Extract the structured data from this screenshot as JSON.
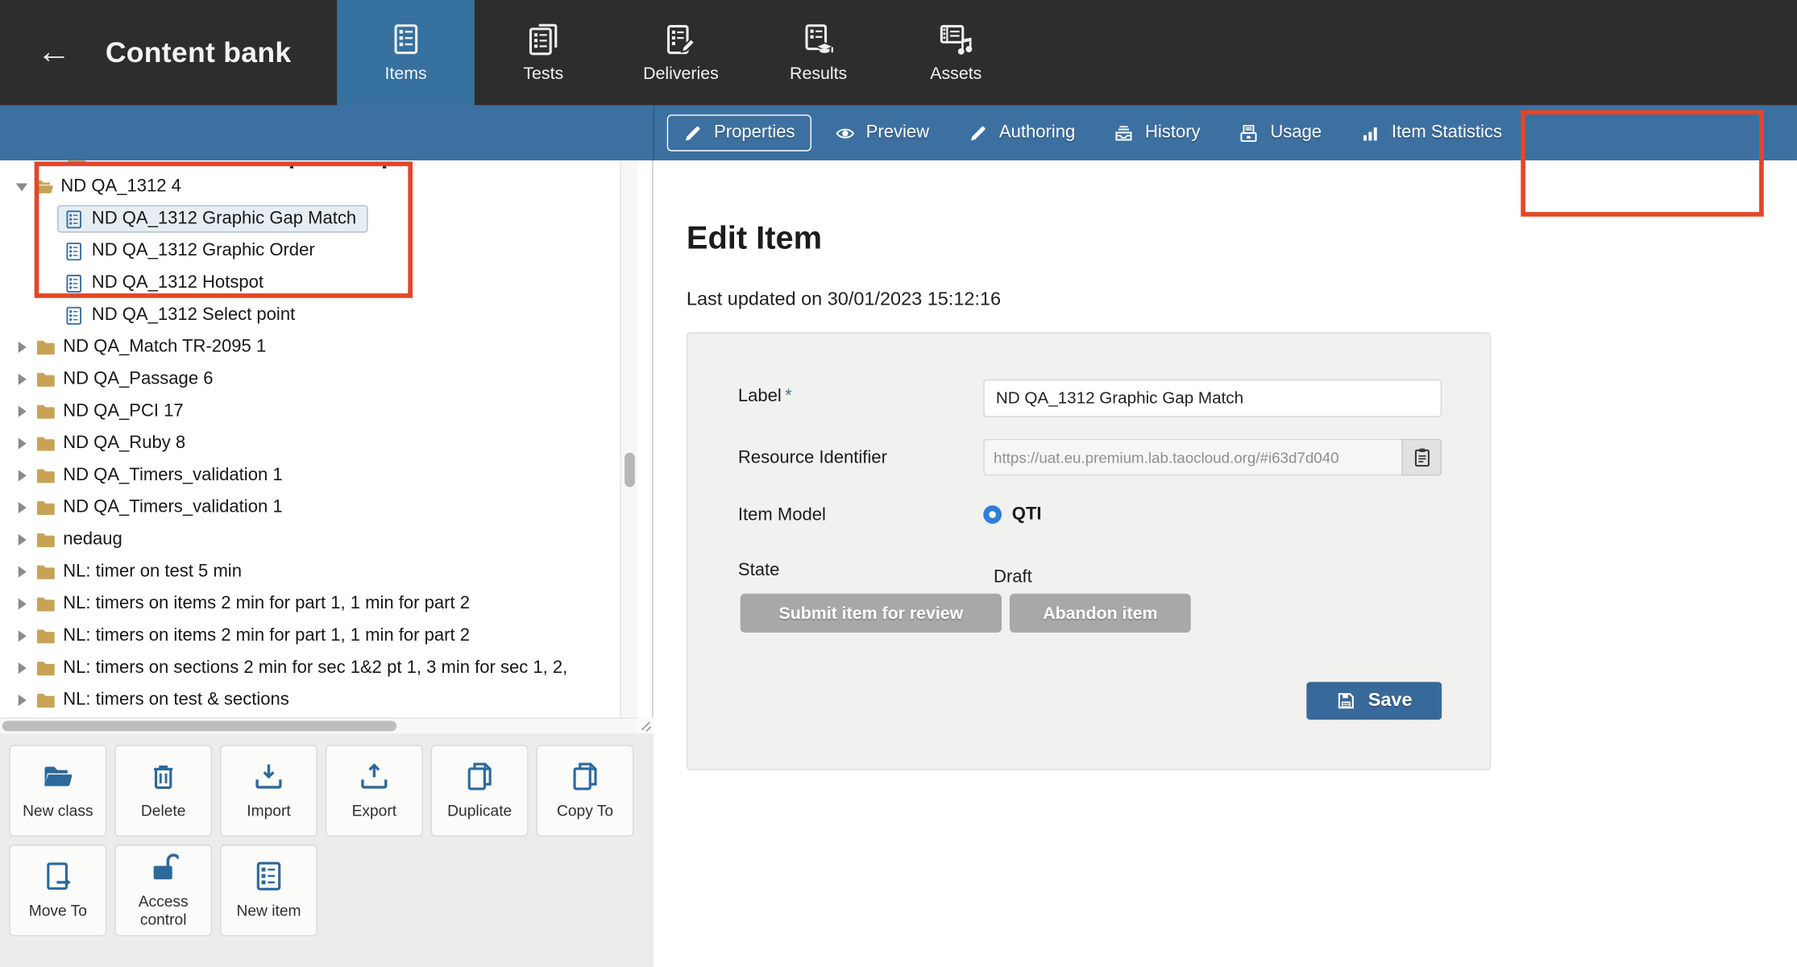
{
  "topnav": {
    "back_glyph": "←",
    "title": "Content bank",
    "tabs": [
      {
        "label": "Items",
        "active": true
      },
      {
        "label": "Tests",
        "active": false
      },
      {
        "label": "Deliveries",
        "active": false
      },
      {
        "label": "Results",
        "active": false
      },
      {
        "label": "Assets",
        "active": false
      }
    ]
  },
  "tabbar": {
    "tabs": [
      {
        "label": "Properties",
        "active": true
      },
      {
        "label": "Preview",
        "active": false
      },
      {
        "label": "Authoring",
        "active": false
      },
      {
        "label": "History",
        "active": false
      },
      {
        "label": "Usage",
        "active": false
      },
      {
        "label": "Item Statistics",
        "active": false
      }
    ]
  },
  "tree": {
    "rows": [
      {
        "type": "folder-open",
        "label": "ND QA_1312 4"
      },
      {
        "type": "item",
        "selected": true,
        "label": "ND QA_1312 Graphic Gap Match"
      },
      {
        "type": "item",
        "label": "ND QA_1312 Graphic Order"
      },
      {
        "type": "item",
        "label": "ND QA_1312 Hotspot"
      },
      {
        "type": "item",
        "label": "ND QA_1312 Select point"
      },
      {
        "type": "folder",
        "label": "ND QA_Match TR-2095 1"
      },
      {
        "type": "folder",
        "label": "ND QA_Passage 6"
      },
      {
        "type": "folder",
        "label": "ND QA_PCI 17"
      },
      {
        "type": "folder",
        "label": "ND QA_Ruby 8"
      },
      {
        "type": "folder",
        "label": "ND QA_Timers_validation 1"
      },
      {
        "type": "folder",
        "label": "ND QA_Timers_validation 1"
      },
      {
        "type": "folder",
        "label": "nedaug"
      },
      {
        "type": "folder",
        "label": "NL: timer on test 5 min"
      },
      {
        "type": "folder",
        "label": "NL: timers on items 2 min for part 1, 1 min for part 2"
      },
      {
        "type": "folder",
        "label": "NL: timers on items 2 min for part 1, 1 min for part 2"
      },
      {
        "type": "folder",
        "label": "NL: timers on sections 2 min for sec 1&2 pt 1, 3 min for sec 1, 2,"
      },
      {
        "type": "folder",
        "label": "NL: timers on test & sections"
      }
    ]
  },
  "actions": {
    "buttons": [
      {
        "label": "New class"
      },
      {
        "label": "Delete"
      },
      {
        "label": "Import"
      },
      {
        "label": "Export"
      },
      {
        "label": "Duplicate"
      },
      {
        "label": "Copy To"
      },
      {
        "label": "Move To"
      },
      {
        "label": "Access control"
      },
      {
        "label": "New item"
      }
    ]
  },
  "main": {
    "title": "Edit Item",
    "last_updated": "Last updated on 30/01/2023 15:12:16",
    "form": {
      "label": {
        "name": "Label",
        "required": "*",
        "value": "ND QA_1312 Graphic Gap Match"
      },
      "resource": {
        "name": "Resource Identifier",
        "value": "https://uat.eu.premium.lab.taocloud.org/#i63d7d040"
      },
      "model": {
        "name": "Item Model",
        "option": "QTI"
      },
      "state": {
        "name": "State",
        "value": "Draft"
      },
      "submit_label": "Submit item for review",
      "abandon_label": "Abandon item",
      "save_label": "Save"
    }
  },
  "icons": {
    "back": "arrow-left",
    "items": "list",
    "tests": "stacked-lists",
    "deliveries": "list-pencil",
    "results": "list-graduation-cap",
    "assets": "film-music-note",
    "properties": "pencil",
    "preview": "eye",
    "authoring": "pencil",
    "history": "archive-tray",
    "usage": "device-list",
    "item_statistics": "bar-chart",
    "new_class": "folder-open",
    "delete": "trash",
    "import": "tray-arrow-down",
    "export": "tray-arrow-up",
    "duplicate": "pages",
    "copy_to": "pages",
    "move_to": "page-arrow-right",
    "access_control": "padlock-open",
    "new_item": "list",
    "save": "floppy-disk",
    "copy_identifier": "clipboard",
    "folder": "folder",
    "tree_item": "list"
  },
  "colors": {
    "nav_dark": "#2d2d2d",
    "bar_blue": "#3c70a0",
    "active_tab_blue": "#36719f",
    "annotation_red": "#e3462b",
    "folder_tan": "#c7a455",
    "item_blue": "#3d72a0",
    "selected_bg": "#e7eef3",
    "panel_bg": "#f1f1ef",
    "button_gray": "#a8a8a8",
    "save_blue": "#38699b",
    "radio_blue": "#2f80dc"
  }
}
